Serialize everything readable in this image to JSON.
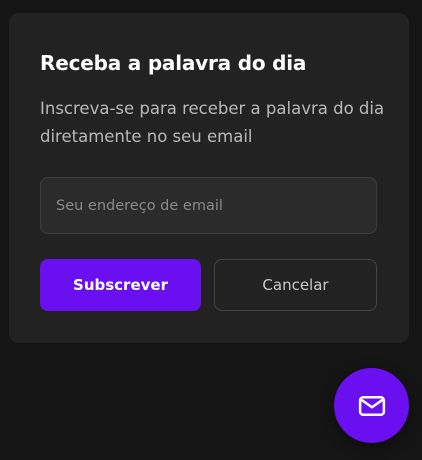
{
  "modal": {
    "title": "Receba a palavra do dia",
    "description": "Inscreva-se para receber a palavra do dia diretamente no seu email",
    "email_field": {
      "value": "",
      "placeholder": "Seu endereço de email"
    },
    "subscribe_label": "Subscrever",
    "cancel_label": "Cancelar"
  },
  "fab": {
    "icon": "mail-icon"
  },
  "colors": {
    "accent": "#6a0ff0",
    "background": "#151515",
    "card": "#222222"
  }
}
